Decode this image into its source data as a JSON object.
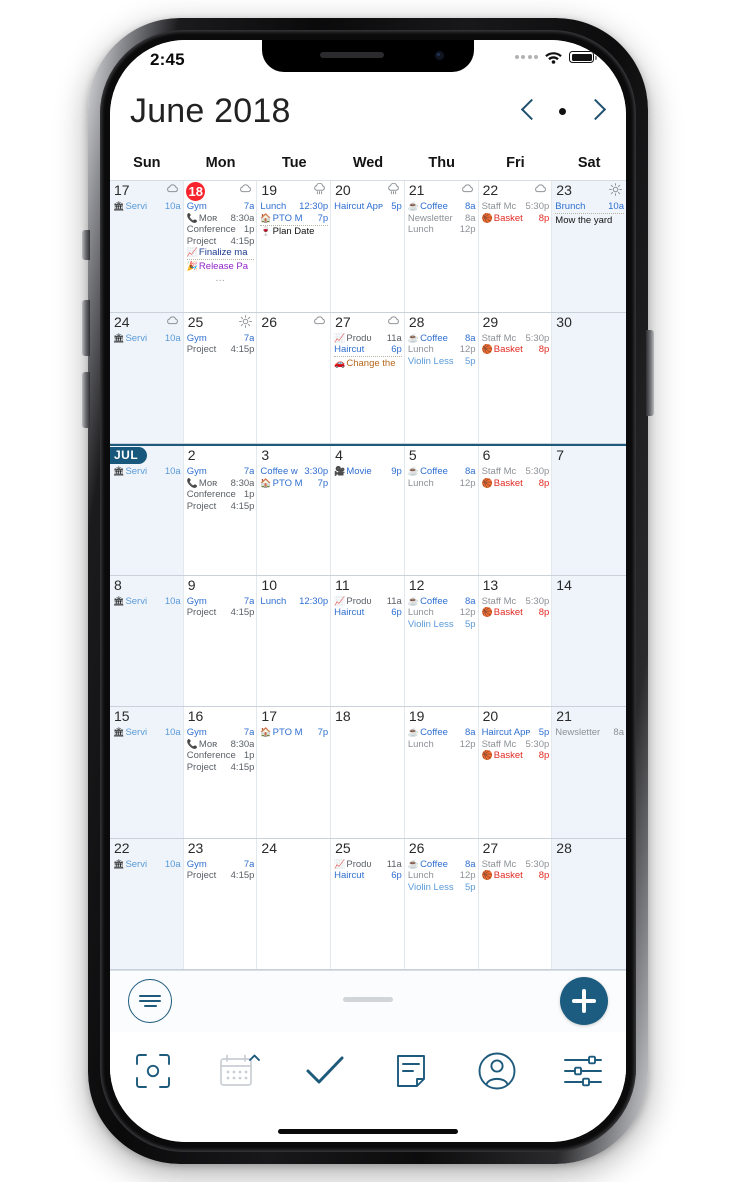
{
  "status_bar": {
    "time": "2:45",
    "wifi_icon": "wifi-icon",
    "battery_icon": "battery-icon",
    "signal_icon": "signal-dots-icon"
  },
  "header": {
    "month_title": "June 2018",
    "prev_icon": "chevron-left-icon",
    "today_dot_icon": "today-dot-icon",
    "next_icon": "chevron-right-icon"
  },
  "weekdays": [
    "Sun",
    "Mon",
    "Tue",
    "Wed",
    "Thu",
    "Fri",
    "Sat"
  ],
  "colors": {
    "accent": "#1c5c80",
    "today_badge": "#f8232c",
    "weekend_bg": "#eef4fa",
    "month_tag_bg": "#17587c",
    "event_blue": "#2f6fd0",
    "event_gray": "#8d9196",
    "event_red": "#e02a23",
    "event_purple": "#9124c9",
    "event_orange": "#b4661c"
  },
  "weeks": [
    {
      "month_start": false,
      "days": [
        {
          "num": "17",
          "weekend": true,
          "weather": "cloud",
          "events": [
            {
              "icon": "🏛",
              "text": "Servi",
              "time": "10a",
              "color": "c-lightblue"
            }
          ]
        },
        {
          "num": "18",
          "today": true,
          "weather": "cloud",
          "events": [
            {
              "text": "Gym",
              "time": "7a",
              "color": "c-blue"
            },
            {
              "icon": "📞",
              "text": "Moʀ",
              "time": "8:30a",
              "color": "c-dark"
            },
            {
              "text": "Conference",
              "time": "1p",
              "color": "c-dark"
            },
            {
              "text": "Project",
              "time": "4:15p",
              "color": "c-dark"
            },
            {
              "icon": "📈",
              "text": "Finalize ma",
              "time": "",
              "color": "c-navy",
              "dotted": true
            },
            {
              "icon": "🎉",
              "text": "Release Pa",
              "time": "",
              "color": "c-purple"
            },
            {
              "ellipsis": true,
              "text": "…"
            }
          ]
        },
        {
          "num": "19",
          "weather": "rain",
          "events": [
            {
              "text": "Lunch",
              "time": "12:30p",
              "color": "c-blue"
            },
            {
              "icon": "🏠",
              "text": "PTO M",
              "time": "7p",
              "color": "c-blue",
              "dotted": true
            },
            {
              "icon": "🍷",
              "text": "Plan Date",
              "time": "",
              "color": "c-black"
            }
          ]
        },
        {
          "num": "20",
          "weather": "rain",
          "events": [
            {
              "text": "Haircut Apᴘ",
              "time": "5p",
              "color": "c-blue"
            }
          ]
        },
        {
          "num": "21",
          "weather": "cloud",
          "events": [
            {
              "icon": "☕",
              "text": "Coffee",
              "time": "8a",
              "color": "c-blue"
            },
            {
              "text": "Newsletter",
              "time": "8a",
              "color": "c-gray"
            },
            {
              "text": "Lunch",
              "time": "12p",
              "color": "c-gray"
            }
          ]
        },
        {
          "num": "22",
          "weather": "cloud",
          "events": [
            {
              "text": "Staff Mᴄ",
              "time": "5:30p",
              "color": "c-gray"
            },
            {
              "icon": "🏀",
              "text": "Basket",
              "time": "8p",
              "color": "c-red"
            }
          ]
        },
        {
          "num": "23",
          "weekend": true,
          "weather": "sun",
          "events": [
            {
              "text": "Brunch",
              "time": "10a",
              "color": "c-blue",
              "dotted": true
            },
            {
              "text": "Mow the yard",
              "time": "",
              "color": "c-black"
            }
          ]
        }
      ]
    },
    {
      "month_start": false,
      "days": [
        {
          "num": "24",
          "weekend": true,
          "weather": "cloud",
          "events": [
            {
              "icon": "🏛",
              "text": "Servi",
              "time": "10a",
              "color": "c-lightblue"
            }
          ]
        },
        {
          "num": "25",
          "weather": "sun",
          "events": [
            {
              "text": "Gym",
              "time": "7a",
              "color": "c-blue"
            },
            {
              "text": "Project",
              "time": "4:15p",
              "color": "c-dark"
            }
          ]
        },
        {
          "num": "26",
          "weather": "cloud",
          "events": []
        },
        {
          "num": "27",
          "weather": "cloud",
          "events": [
            {
              "icon": "📈",
              "text": "Prodᴜ",
              "time": "11a",
              "color": "c-dark"
            },
            {
              "text": "Haircut",
              "time": "6p",
              "color": "c-blue",
              "dotted": true
            },
            {
              "icon": "🚗",
              "text": "Change the",
              "time": "",
              "color": "c-orange"
            }
          ]
        },
        {
          "num": "28",
          "weather": "",
          "events": [
            {
              "icon": "☕",
              "text": "Coffee",
              "time": "8a",
              "color": "c-blue"
            },
            {
              "text": "Lunch",
              "time": "12p",
              "color": "c-gray"
            },
            {
              "text": "Violin Less",
              "time": "5p",
              "color": "c-lightblue"
            }
          ]
        },
        {
          "num": "29",
          "weather": "",
          "events": [
            {
              "text": "Staff Mᴄ",
              "time": "5:30p",
              "color": "c-gray"
            },
            {
              "icon": "🏀",
              "text": "Basket",
              "time": "8p",
              "color": "c-red"
            }
          ]
        },
        {
          "num": "30",
          "weekend": true,
          "weather": "",
          "events": []
        }
      ]
    },
    {
      "month_start": true,
      "days": [
        {
          "num": "JUL",
          "month_tag": true,
          "weekend": true,
          "weather": "",
          "events": [
            {
              "icon": "🏛",
              "text": "Servi",
              "time": "10a",
              "color": "c-lightblue"
            }
          ]
        },
        {
          "num": "2",
          "weather": "",
          "events": [
            {
              "text": "Gym",
              "time": "7a",
              "color": "c-blue"
            },
            {
              "icon": "📞",
              "text": "Moʀ",
              "time": "8:30a",
              "color": "c-dark"
            },
            {
              "text": "Conference",
              "time": "1p",
              "color": "c-dark"
            },
            {
              "text": "Project",
              "time": "4:15p",
              "color": "c-dark"
            }
          ]
        },
        {
          "num": "3",
          "weather": "",
          "events": [
            {
              "text": "Coffee ᴡ",
              "time": "3:30p",
              "color": "c-blue"
            },
            {
              "icon": "🏠",
              "text": "PTO M",
              "time": "7p",
              "color": "c-blue"
            }
          ]
        },
        {
          "num": "4",
          "weather": "",
          "events": [
            {
              "icon": "🎥",
              "text": "Movie",
              "time": "9p",
              "color": "c-blue"
            }
          ]
        },
        {
          "num": "5",
          "weather": "",
          "events": [
            {
              "icon": "☕",
              "text": "Coffee",
              "time": "8a",
              "color": "c-blue"
            },
            {
              "text": "Lunch",
              "time": "12p",
              "color": "c-gray"
            }
          ]
        },
        {
          "num": "6",
          "weather": "",
          "events": [
            {
              "text": "Staff Mᴄ",
              "time": "5:30p",
              "color": "c-gray"
            },
            {
              "icon": "🏀",
              "text": "Basket",
              "time": "8p",
              "color": "c-red"
            }
          ]
        },
        {
          "num": "7",
          "weekend": true,
          "weather": "",
          "events": []
        }
      ]
    },
    {
      "month_start": false,
      "days": [
        {
          "num": "8",
          "weekend": true,
          "weather": "",
          "events": [
            {
              "icon": "🏛",
              "text": "Servi",
              "time": "10a",
              "color": "c-lightblue"
            }
          ]
        },
        {
          "num": "9",
          "weather": "",
          "events": [
            {
              "text": "Gym",
              "time": "7a",
              "color": "c-blue"
            },
            {
              "text": "Project",
              "time": "4:15p",
              "color": "c-dark"
            }
          ]
        },
        {
          "num": "10",
          "weather": "",
          "events": [
            {
              "text": "Lunch",
              "time": "12:30p",
              "color": "c-blue"
            }
          ]
        },
        {
          "num": "11",
          "weather": "",
          "events": [
            {
              "icon": "📈",
              "text": "Prodᴜ",
              "time": "11a",
              "color": "c-dark"
            },
            {
              "text": "Haircut",
              "time": "6p",
              "color": "c-blue"
            }
          ]
        },
        {
          "num": "12",
          "weather": "",
          "events": [
            {
              "icon": "☕",
              "text": "Coffee",
              "time": "8a",
              "color": "c-blue"
            },
            {
              "text": "Lunch",
              "time": "12p",
              "color": "c-gray"
            },
            {
              "text": "Violin Less",
              "time": "5p",
              "color": "c-lightblue"
            }
          ]
        },
        {
          "num": "13",
          "weather": "",
          "events": [
            {
              "text": "Staff Mᴄ",
              "time": "5:30p",
              "color": "c-gray"
            },
            {
              "icon": "🏀",
              "text": "Basket",
              "time": "8p",
              "color": "c-red"
            }
          ]
        },
        {
          "num": "14",
          "weekend": true,
          "weather": "",
          "events": []
        }
      ]
    },
    {
      "month_start": false,
      "days": [
        {
          "num": "15",
          "weekend": true,
          "weather": "",
          "events": [
            {
              "icon": "🏛",
              "text": "Servi",
              "time": "10a",
              "color": "c-lightblue"
            }
          ]
        },
        {
          "num": "16",
          "weather": "",
          "events": [
            {
              "text": "Gym",
              "time": "7a",
              "color": "c-blue"
            },
            {
              "icon": "📞",
              "text": "Moʀ",
              "time": "8:30a",
              "color": "c-dark"
            },
            {
              "text": "Conference",
              "time": "1p",
              "color": "c-dark"
            },
            {
              "text": "Project",
              "time": "4:15p",
              "color": "c-dark"
            }
          ]
        },
        {
          "num": "17",
          "weather": "",
          "events": [
            {
              "icon": "🏠",
              "text": "PTO M",
              "time": "7p",
              "color": "c-blue"
            }
          ]
        },
        {
          "num": "18",
          "weather": "",
          "events": []
        },
        {
          "num": "19",
          "weather": "",
          "events": [
            {
              "icon": "☕",
              "text": "Coffee",
              "time": "8a",
              "color": "c-blue"
            },
            {
              "text": "Lunch",
              "time": "12p",
              "color": "c-gray"
            }
          ]
        },
        {
          "num": "20",
          "weather": "",
          "events": [
            {
              "text": "Haircut Apᴘ",
              "time": "5p",
              "color": "c-blue"
            },
            {
              "text": "Staff Mᴄ",
              "time": "5:30p",
              "color": "c-gray"
            },
            {
              "icon": "🏀",
              "text": "Basket",
              "time": "8p",
              "color": "c-red"
            }
          ]
        },
        {
          "num": "21",
          "weekend": true,
          "weather": "",
          "events": [
            {
              "text": "Newsletter",
              "time": "8a",
              "color": "c-gray"
            }
          ]
        }
      ]
    },
    {
      "month_start": false,
      "days": [
        {
          "num": "22",
          "weekend": true,
          "weather": "",
          "events": [
            {
              "icon": "🏛",
              "text": "Servi",
              "time": "10a",
              "color": "c-lightblue"
            }
          ]
        },
        {
          "num": "23",
          "weather": "",
          "events": [
            {
              "text": "Gym",
              "time": "7a",
              "color": "c-blue"
            },
            {
              "text": "Project",
              "time": "4:15p",
              "color": "c-dark"
            }
          ]
        },
        {
          "num": "24",
          "weather": "",
          "events": []
        },
        {
          "num": "25",
          "weather": "",
          "events": [
            {
              "icon": "📈",
              "text": "Prodᴜ",
              "time": "11a",
              "color": "c-dark"
            },
            {
              "text": "Haircut",
              "time": "6p",
              "color": "c-blue"
            }
          ]
        },
        {
          "num": "26",
          "weather": "",
          "events": [
            {
              "icon": "☕",
              "text": "Coffee",
              "time": "8a",
              "color": "c-blue"
            },
            {
              "text": "Lunch",
              "time": "12p",
              "color": "c-gray"
            },
            {
              "text": "Violin Less",
              "time": "5p",
              "color": "c-lightblue"
            }
          ]
        },
        {
          "num": "27",
          "weather": "",
          "events": [
            {
              "text": "Staff Mᴄ",
              "time": "5:30p",
              "color": "c-gray"
            },
            {
              "icon": "🏀",
              "text": "Basket",
              "time": "8p",
              "color": "c-red"
            }
          ]
        },
        {
          "num": "28",
          "weekend": true,
          "weather": "",
          "events": []
        }
      ]
    }
  ],
  "action_bar": {
    "filter_icon": "filter-lines-icon",
    "drag_handle_icon": "drag-handle-icon",
    "add_icon": "plus-icon"
  },
  "tab_bar": {
    "tabs": [
      {
        "icon": "scan-focus-icon",
        "label": ""
      },
      {
        "icon": "calendar-icon",
        "label": ""
      },
      {
        "icon": "checkmark-icon",
        "label": ""
      },
      {
        "icon": "note-icon",
        "label": ""
      },
      {
        "icon": "person-icon",
        "label": ""
      },
      {
        "icon": "sliders-icon",
        "label": ""
      }
    ],
    "floating_icon": "camera-icon"
  }
}
